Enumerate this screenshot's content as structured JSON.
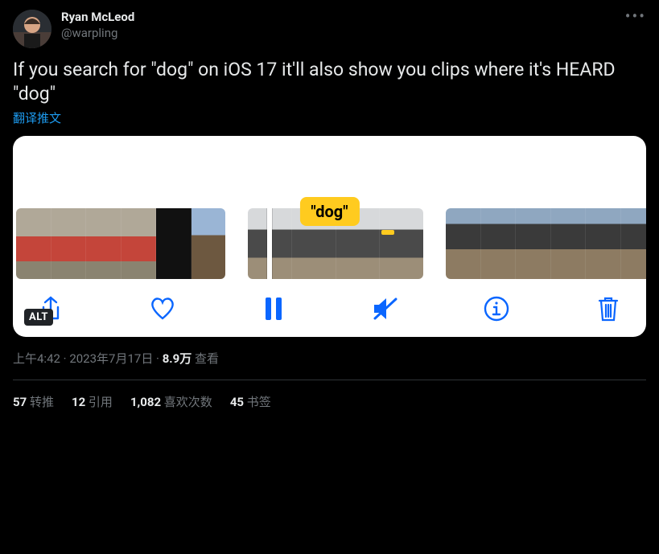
{
  "author": {
    "display_name": "Ryan McLeod",
    "handle": "@warpling"
  },
  "tweet_text": "If you search for \"dog\" on iOS 17 it'll also show you clips where it's HEARD \"dog\"",
  "translate_label": "翻译推文",
  "media": {
    "caption_word": "\"dog\"",
    "alt_label": "ALT",
    "toolbar_icons": [
      "share-icon",
      "heart-icon",
      "pause-icon",
      "mute-icon",
      "info-icon",
      "trash-icon"
    ]
  },
  "meta": {
    "time": "上午4:42",
    "date": "2023年7月17日",
    "views_count": "8.9万",
    "views_label": "查看"
  },
  "stats": {
    "retweets": {
      "count": "57",
      "label": "转推"
    },
    "quotes": {
      "count": "12",
      "label": "引用"
    },
    "likes": {
      "count": "1,082",
      "label": "喜欢次数"
    },
    "bookmarks": {
      "count": "45",
      "label": "书签"
    }
  }
}
